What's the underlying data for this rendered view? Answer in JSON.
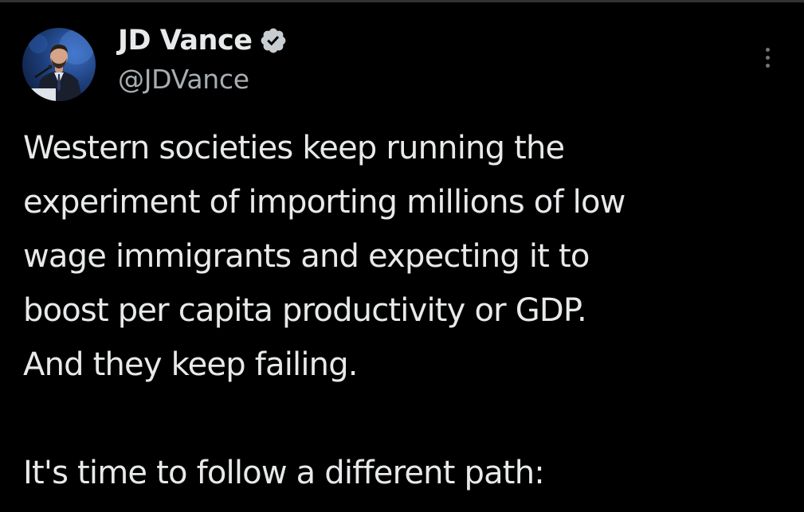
{
  "tweet": {
    "author": {
      "display_name": "JD Vance",
      "handle": "@JDVance",
      "verified": true,
      "avatar_icon": "profile-photo"
    },
    "more_icon": "more-options-icon",
    "text": {
      "paragraph_1": "Western societies keep running the\nexperiment of importing millions of low\nwage immigrants and expecting it to\nboost per capita productivity or GDP.\nAnd they keep failing.",
      "paragraph_2": "It's time to follow a different path:"
    }
  },
  "colors": {
    "background": "#000000",
    "text_primary": "#e7e9ea",
    "text_secondary": "#a8adb2",
    "verified_badge": "#c8cdd2"
  }
}
